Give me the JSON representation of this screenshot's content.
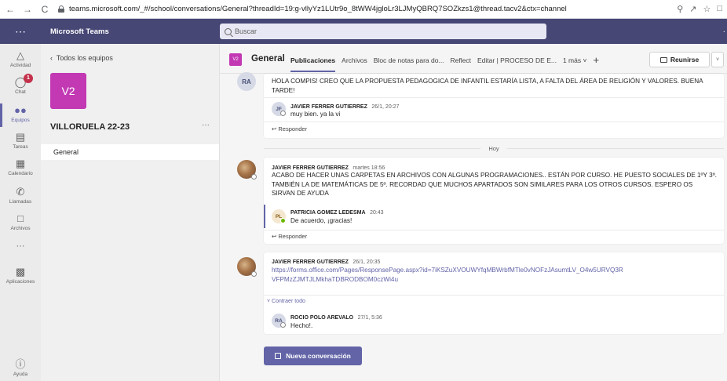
{
  "browser": {
    "back": "←",
    "forward": "→",
    "reload": "C",
    "url": "teams.microsoft.com/_#/school/conversations/General?threadId=19:g-vllyYz1LUtr9o_8tWW4jgloLr3LJMyQBRQ7SOZkzs1@thread.tacv2&ctx=channel"
  },
  "topbar": {
    "app_name": "Microsoft Teams",
    "search_placeholder": "Buscar"
  },
  "rail": {
    "items": [
      {
        "label": "Actividad",
        "icon": "bell-icon"
      },
      {
        "label": "Chat",
        "icon": "chat-icon",
        "badge": "1"
      },
      {
        "label": "Equipos",
        "icon": "teams-icon"
      },
      {
        "label": "Tareas",
        "icon": "assignments-icon"
      },
      {
        "label": "Calendario",
        "icon": "calendar-icon"
      },
      {
        "label": "Llamadas",
        "icon": "phone-icon"
      },
      {
        "label": "Archivos",
        "icon": "file-icon"
      },
      {
        "label": "Aplicaciones",
        "icon": "apps-icon"
      },
      {
        "label": "Ayuda",
        "icon": "help-icon"
      }
    ],
    "more": "···"
  },
  "team_panel": {
    "back_label": "Todos los equipos",
    "avatar": "V2",
    "team_name": "VILLORUELA 22-23",
    "more": "···",
    "channels": [
      "General"
    ]
  },
  "channel": {
    "avatar": "V2",
    "name": "General",
    "tabs": [
      "Publicaciones",
      "Archivos",
      "Bloc de notas para do...",
      "Reflect",
      "Editar | PROCESO DE E...",
      "1 más"
    ],
    "meet_label": "Reunirse"
  },
  "posts": {
    "p1": {
      "avatar": "RA",
      "text": "HOLA COMPIS! CREO QUE LA PROPUESTA PEDAGOGICA DE INFANTIL ESTARÍA LISTA, A FALTA DEL ÁREA DE RELIGIÓN Y VALORES. BUENA TARDE!",
      "reply": {
        "author": "JAVIER FERRER GUTIERREZ",
        "time": "26/1, 20:27",
        "text": "muy bien. ya la vi"
      },
      "reply_label": "Responder"
    },
    "day_separator": "Hoy",
    "p2": {
      "author": "JAVIER FERRER GUTIERREZ",
      "time": "martes 18:56",
      "text": "ACABO DE HACER UNAS CARPETAS EN ARCHIVOS CON ALGUNAS PROGRAMACIONES.. ESTÁN POR CURSO. HE PUESTO SOCIALES DE 1ºY 3º. TAMBIÉN LA DE MATEMÁTICAS DE 5º. RECORDAD QUE MUCHOS APARTADOS SON SIMILARES PARA LOS OTROS CURSOS. ESPERO OS SIRVAN DE AYUDA",
      "reply": {
        "avatar": "PL",
        "author": "PATRICIA GOMEZ LEDESMA",
        "time": "20:43",
        "text": "De acuerdo, ¡gracias!"
      },
      "reply_label": "Responder"
    },
    "p3": {
      "author": "JAVIER FERRER GUTIERREZ",
      "time": "26/1, 20:35",
      "link": "https://forms.office.com/Pages/ResponsePage.aspx?id=7iKSZuXVOUWYfqMBWrbfMTle0vNOFzJAsumtLV_O4w5URVQ3RVFPMzZJMTJLMkhaTDBRODBOM0czWi4u",
      "collapse_label": "Contraer todo",
      "reply": {
        "avatar": "RA",
        "author": "ROCIO POLO AREVALO",
        "time": "27/1, 5:36",
        "text": "Hecho!."
      }
    }
  },
  "new_conversation_label": "Nueva conversación"
}
